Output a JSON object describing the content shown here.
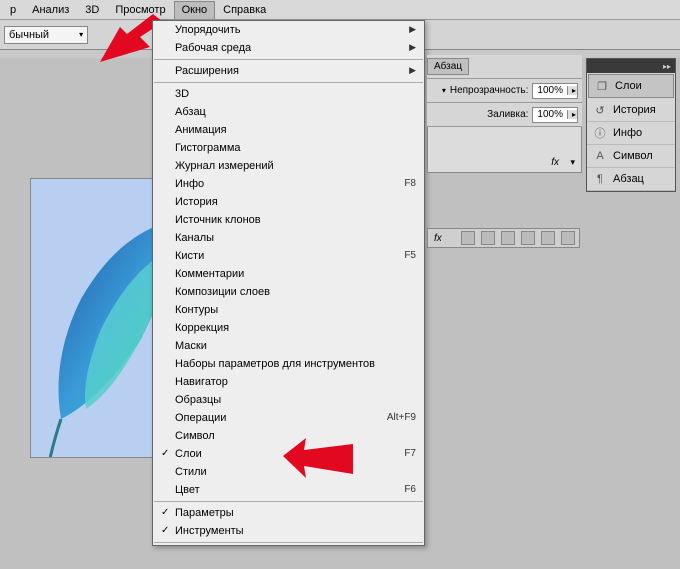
{
  "menubar": {
    "items": [
      "р",
      "Анализ",
      "3D",
      "Просмотр",
      "Окно",
      "Справка"
    ],
    "open_index": 4
  },
  "optionsbar": {
    "field1": "бычный"
  },
  "dropdown": {
    "groups": [
      [
        {
          "label": "Упорядочить",
          "sub": true
        },
        {
          "label": "Рабочая среда",
          "sub": true
        }
      ],
      [
        {
          "label": "Расширения",
          "sub": true
        }
      ],
      [
        {
          "label": "3D"
        },
        {
          "label": "Абзац"
        },
        {
          "label": "Анимация"
        },
        {
          "label": "Гистограмма"
        },
        {
          "label": "Журнал измерений"
        },
        {
          "label": "Инфо",
          "shortcut": "F8"
        },
        {
          "label": "История"
        },
        {
          "label": "Источник клонов"
        },
        {
          "label": "Каналы"
        },
        {
          "label": "Кисти",
          "shortcut": "F5"
        },
        {
          "label": "Комментарии"
        },
        {
          "label": "Композиции слоев"
        },
        {
          "label": "Контуры"
        },
        {
          "label": "Коррекция"
        },
        {
          "label": "Маски"
        },
        {
          "label": "Наборы параметров для инструментов"
        },
        {
          "label": "Навигатор"
        },
        {
          "label": "Образцы"
        },
        {
          "label": "Операции",
          "shortcut": "Alt+F9"
        },
        {
          "label": "Символ"
        },
        {
          "label": "Слои",
          "shortcut": "F7",
          "checked": true
        },
        {
          "label": "Стили"
        },
        {
          "label": "Цвет",
          "shortcut": "F6"
        }
      ],
      [
        {
          "label": "Параметры",
          "checked": true
        },
        {
          "label": "Инструменты",
          "checked": true
        }
      ]
    ]
  },
  "rightpanel": {
    "tab": "Абзац",
    "opacity_label": "Непрозрачность:",
    "opacity_value": "100%",
    "fill_label": "Заливка:",
    "fill_value": "100%",
    "fx_label": "fx"
  },
  "dock": {
    "items": [
      {
        "icon": "layers-icon",
        "label": "Слои",
        "active": true
      },
      {
        "icon": "history-icon",
        "label": "История"
      },
      {
        "icon": "info-icon",
        "label": "Инфо"
      },
      {
        "icon": "character-icon",
        "label": "Символ"
      },
      {
        "icon": "paragraph-icon",
        "label": "Абзац"
      }
    ]
  }
}
